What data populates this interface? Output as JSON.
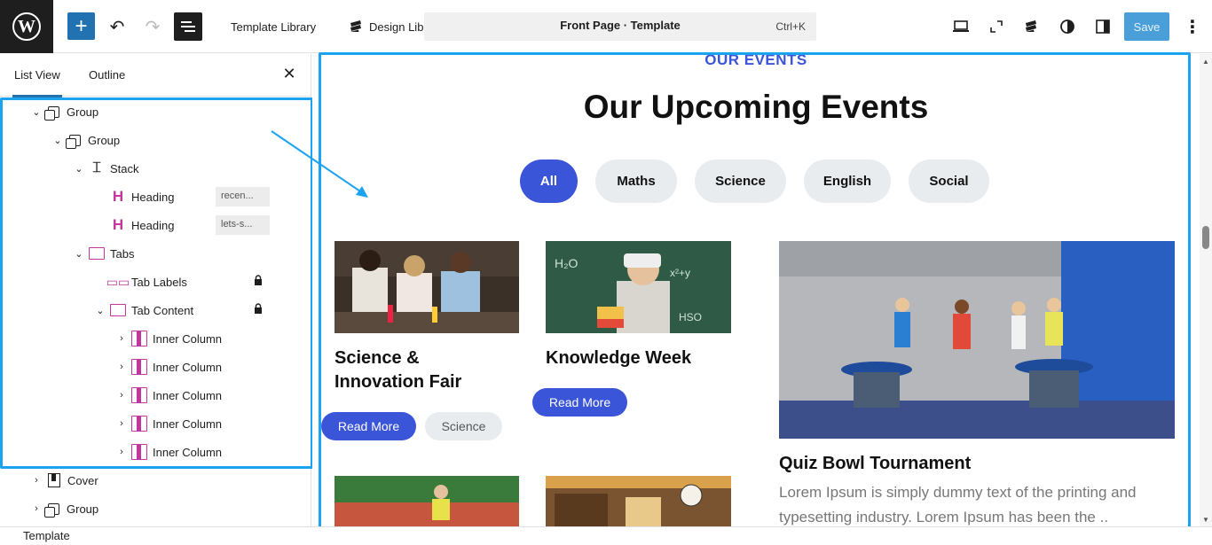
{
  "toolbar": {
    "template_library": "Template Library",
    "design_library": "Design Library",
    "command_title": "Front Page · Template",
    "command_shortcut": "Ctrl+K",
    "save": "Save",
    "add_symbol": "+",
    "undo_symbol": "↶",
    "redo_symbol": "↷",
    "more_symbol": "⋮"
  },
  "panel": {
    "tab_list_view": "List View",
    "tab_outline": "Outline",
    "close_symbol": "✕"
  },
  "tree": [
    {
      "label": "Group",
      "icon": "group-icon",
      "chevron": "⌄"
    },
    {
      "label": "Group",
      "icon": "group-icon",
      "chevron": "⌄"
    },
    {
      "label": "Stack",
      "icon": "stack-icon",
      "chevron": "⌄"
    },
    {
      "label": "Heading",
      "icon": "heading-icon",
      "tag": "recen..."
    },
    {
      "label": "Heading",
      "icon": "heading-icon",
      "tag": "lets-s..."
    },
    {
      "label": "Tabs",
      "icon": "tabs-icon",
      "chevron": "⌄"
    },
    {
      "label": "Tab Labels",
      "icon": "tab-labels-icon",
      "locked": true
    },
    {
      "label": "Tab Content",
      "icon": "tabs-icon",
      "chevron": "⌄",
      "locked": true
    },
    {
      "label": "Inner Column",
      "icon": "column-icon",
      "chevron": "›"
    },
    {
      "label": "Inner Column",
      "icon": "column-icon",
      "chevron": "›"
    },
    {
      "label": "Inner Column",
      "icon": "column-icon",
      "chevron": "›"
    },
    {
      "label": "Inner Column",
      "icon": "column-icon",
      "chevron": "›"
    },
    {
      "label": "Inner Column",
      "icon": "column-icon",
      "chevron": "›"
    },
    {
      "label": "Cover",
      "icon": "cover-icon",
      "chevron": "›"
    },
    {
      "label": "Group",
      "icon": "group-icon",
      "chevron": "›"
    }
  ],
  "status_bar": {
    "label": "Template"
  },
  "page": {
    "eyebrow": "OUR EVENTS",
    "heading": "Our Upcoming Events",
    "filters": [
      "All",
      "Maths",
      "Science",
      "English",
      "Social"
    ],
    "cards": [
      {
        "title_line1": "Science &",
        "title_line2": "Innovation Fair",
        "button": "Read More",
        "tag": "Science"
      },
      {
        "title_line1": "Knowledge Week",
        "button": "Read More"
      },
      {
        "title_line1": "Quiz Bowl Tournament",
        "description_line1": "Lorem Ipsum is simply dummy text of the printing and",
        "description_line2": "typesetting industry. Lorem Ipsum has been the .."
      }
    ]
  },
  "colors": {
    "accent": "#3b55d9",
    "selection": "#1ba3f2",
    "wp_blue": "#2271b1",
    "heading_icon": "#c2379e"
  }
}
